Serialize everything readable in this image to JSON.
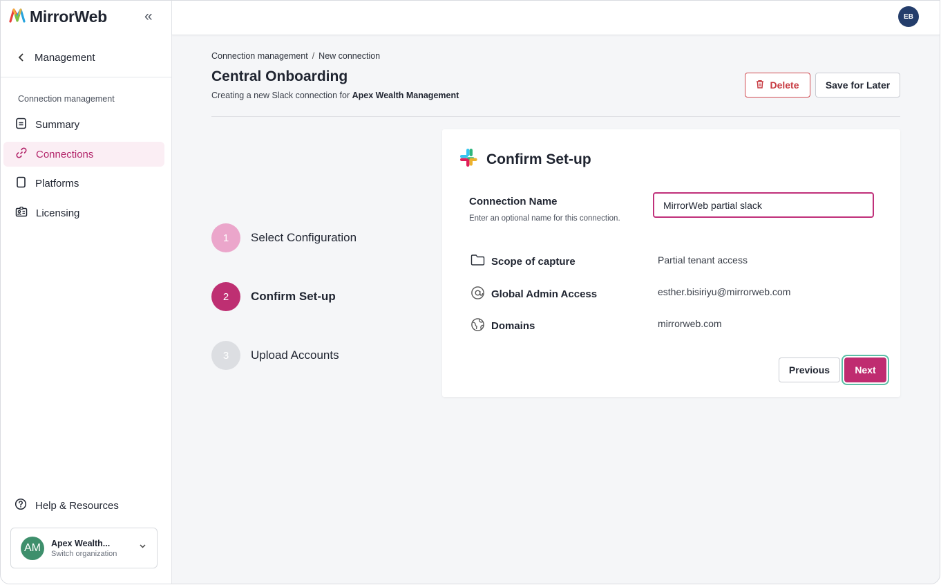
{
  "sidebar": {
    "brand": "MirrorWeb",
    "collapse_icon": "«",
    "back_label": "Management",
    "section_label": "Connection management",
    "items": [
      {
        "label": "Summary",
        "icon": "document-icon"
      },
      {
        "label": "Connections",
        "icon": "link-icon",
        "active": true
      },
      {
        "label": "Platforms",
        "icon": "device-icon"
      },
      {
        "label": "Licensing",
        "icon": "id-card-icon"
      }
    ],
    "help_label": "Help & Resources",
    "org": {
      "initials": "AM",
      "name": "Apex Wealth...",
      "sub": "Switch organization"
    }
  },
  "topbar": {
    "user_initials": "EB"
  },
  "header": {
    "breadcrumb": {
      "parent": "Connection management",
      "separator": "/",
      "current": "New connection"
    },
    "title": "Central Onboarding",
    "subtitle_prefix": "Creating a new Slack connection for ",
    "subtitle_org": "Apex Wealth Management",
    "delete_label": "Delete",
    "save_label": "Save for Later"
  },
  "stepper": [
    {
      "number": "1",
      "label": "Select Configuration",
      "state": "done"
    },
    {
      "number": "2",
      "label": "Confirm Set-up",
      "state": "current"
    },
    {
      "number": "3",
      "label": "Upload Accounts",
      "state": "todo"
    }
  ],
  "card": {
    "title": "Confirm Set-up",
    "connection_name": {
      "label": "Connection Name",
      "help": "Enter an optional name for this connection.",
      "value": "MirrorWeb partial slack"
    },
    "rows": [
      {
        "label": "Scope of capture",
        "value": "Partial tenant access",
        "icon": "folder-icon"
      },
      {
        "label": "Global Admin Access",
        "value": "esther.bisiriyu@mirrorweb.com",
        "icon": "at-sign-icon"
      },
      {
        "label": "Domains",
        "value": "mirrorweb.com",
        "icon": "globe-icon"
      }
    ],
    "previous_label": "Previous",
    "next_label": "Next"
  },
  "colors": {
    "accent": "#BF2C70",
    "active_bg": "#FBEEF4",
    "danger": "#C73A41",
    "focus_ring": "#5BBFA6"
  }
}
